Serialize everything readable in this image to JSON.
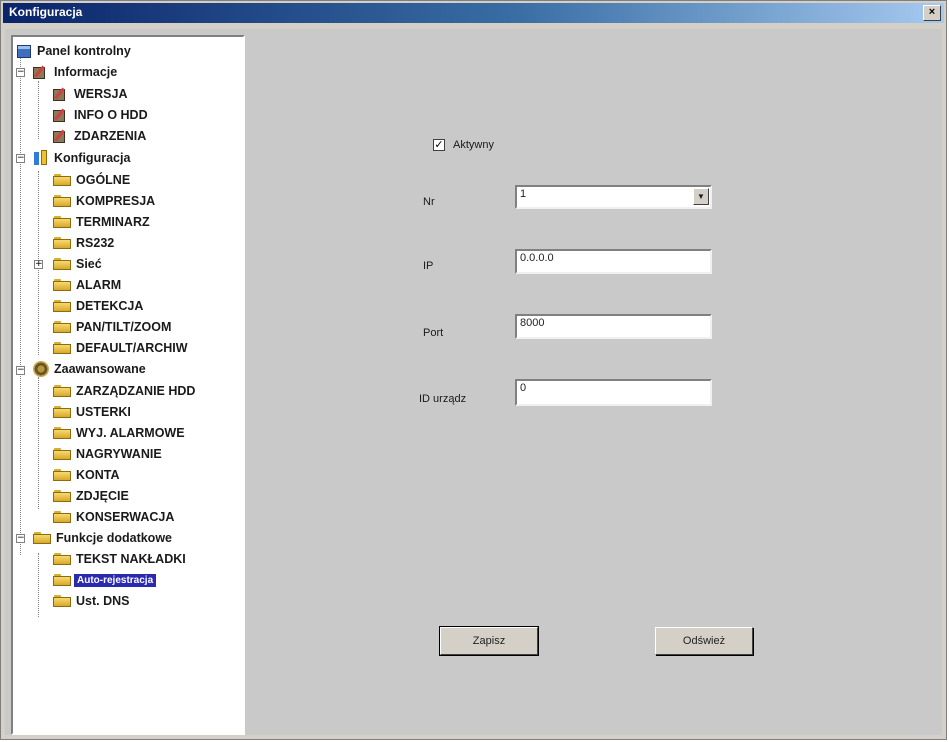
{
  "window": {
    "title": "Konfiguracja",
    "close_label": "×"
  },
  "tree": {
    "root": "Panel kontrolny",
    "informacje": {
      "label": "Informacje",
      "children": [
        "WERSJA",
        "INFO O HDD",
        "ZDARZENIA"
      ]
    },
    "konfiguracja": {
      "label": "Konfiguracja",
      "children": [
        "OGÓLNE",
        "KOMPRESJA",
        "TERMINARZ",
        "RS232",
        "Sieć",
        "ALARM",
        "DETEKCJA",
        "PAN/TILT/ZOOM",
        "DEFAULT/ARCHIW"
      ]
    },
    "zaawansowane": {
      "label": "Zaawansowane",
      "children": [
        "ZARZĄDZANIE HDD",
        "USTERKI",
        "WYJ. ALARMOWE",
        "NAGRYWANIE",
        "KONTA",
        "ZDJĘCIE",
        "KONSERWACJA"
      ]
    },
    "funkcje": {
      "label": "Funkcje dodatkowe",
      "children": [
        "TEKST NAKŁADKI",
        "Auto-rejestracja",
        "Ust. DNS"
      ]
    },
    "selected": "Auto-rejestracja"
  },
  "form": {
    "active_checkbox": {
      "label": "Aktywny",
      "checked": true,
      "mark": "✓"
    },
    "nr": {
      "label": "Nr",
      "value": "1"
    },
    "ip": {
      "label": "IP",
      "value": "0.0.0.0"
    },
    "port": {
      "label": "Port",
      "value": "8000"
    },
    "device_id": {
      "label": "ID urządz",
      "value": "0"
    }
  },
  "buttons": {
    "save": "Zapisz",
    "refresh": "Odśwież"
  }
}
